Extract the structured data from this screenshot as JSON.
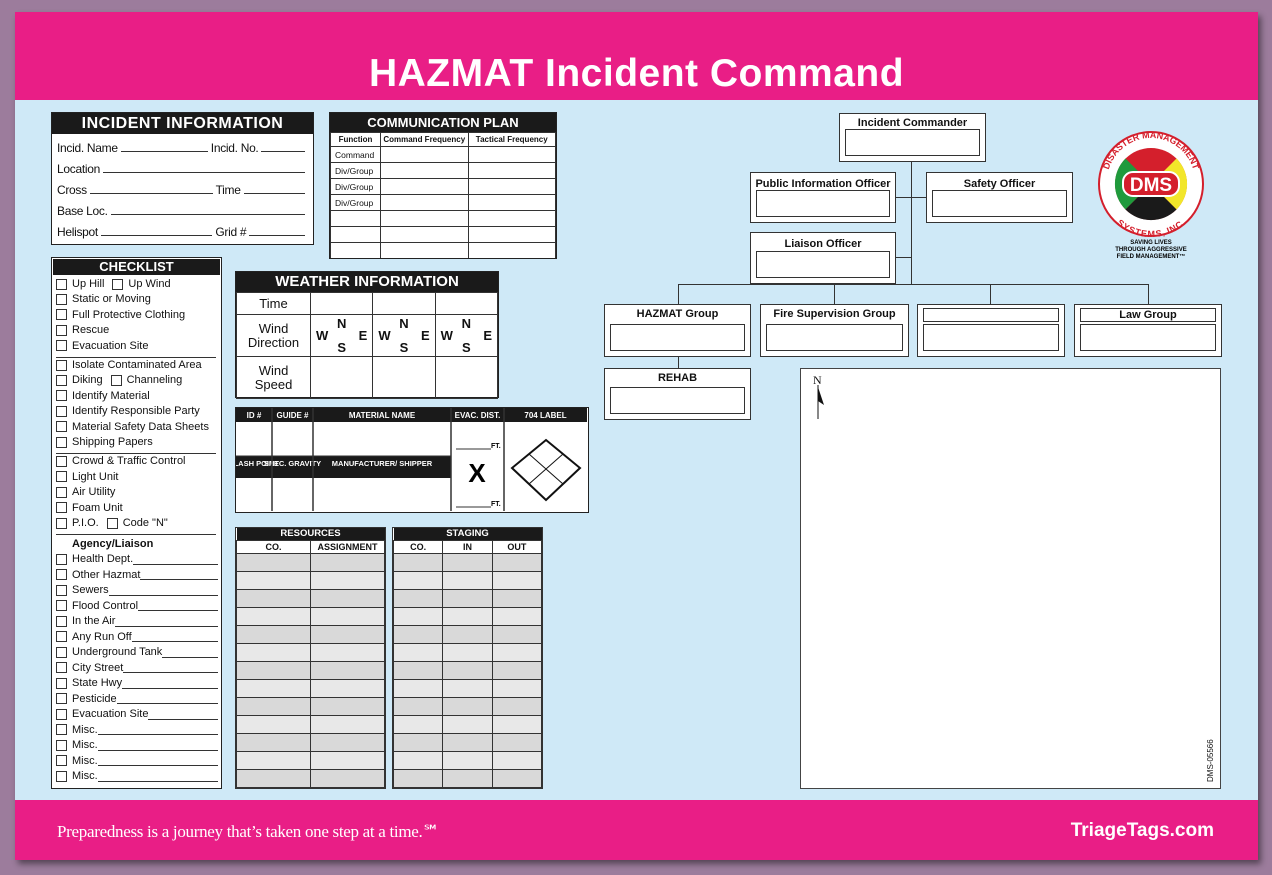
{
  "title": "HAZMAT Incident Command",
  "colors": {
    "brand_pink": "#e91e86",
    "board_blue": "#cfe9f7",
    "header_black": "#1a1a1a"
  },
  "incident_info": {
    "heading": "INCIDENT INFORMATION",
    "rows": [
      [
        "Incid. Name",
        "Incid. No."
      ],
      [
        "Location"
      ],
      [
        "Cross",
        "Time"
      ],
      [
        "Base Loc."
      ],
      [
        "Helispot",
        "Grid #"
      ]
    ]
  },
  "comm_plan": {
    "heading": "COMMUNICATION PLAN",
    "columns": [
      "Function",
      "Command Frequency",
      "Tactical Frequency"
    ],
    "rows": [
      "Command",
      "Div/Group",
      "Div/Group",
      "Div/Group",
      "",
      "",
      ""
    ]
  },
  "checklist": {
    "heading": "CHECKLIST",
    "groups": [
      [
        [
          "Up Hill",
          "Up Wind"
        ],
        [
          "Static or Moving"
        ],
        [
          "Full Protective Clothing"
        ],
        [
          "Rescue"
        ],
        [
          "Evacuation Site"
        ]
      ],
      [
        [
          "Isolate Contaminated Area"
        ],
        [
          "Diking",
          "Channeling"
        ],
        [
          "Identify Material"
        ],
        [
          "Identify Responsible Party"
        ],
        [
          "Material Safety Data Sheets"
        ],
        [
          "Shipping Papers"
        ]
      ],
      [
        [
          "Crowd & Traffic Control"
        ],
        [
          "Light Unit"
        ],
        [
          "Air Utility"
        ],
        [
          "Foam Unit"
        ],
        [
          "P.I.O.",
          "Code \"N\""
        ]
      ]
    ],
    "agency_heading": "Agency/Liaison",
    "agency_items": [
      "Health Dept.",
      "Other Hazmat",
      "Sewers",
      "Flood Control",
      "In the Air",
      "Any Run Off",
      "Underground Tank",
      "City Street",
      "State Hwy",
      "Pesticide",
      "Evacuation Site",
      "Misc.",
      "Misc.",
      "Misc.",
      "Misc."
    ]
  },
  "weather": {
    "heading": "WEATHER INFORMATION",
    "rows": [
      "Time",
      "Wind Direction",
      "Wind Speed"
    ],
    "compass": {
      "n": "N",
      "s": "S",
      "e": "E",
      "w": "W"
    }
  },
  "material": {
    "top_headers": [
      "ID #",
      "GUIDE #",
      "MATERIAL NAME",
      "EVAC. DIST.",
      "704 LABEL"
    ],
    "bottom_headers": [
      "FLASH POINT",
      "SPEC. GRAVITY",
      "MANUFACTURER/ SHIPPER"
    ],
    "ft": "FT.",
    "x_mark": "X"
  },
  "resources": {
    "heading": "RESOURCES",
    "columns": [
      "CO.",
      "ASSIGNMENT"
    ]
  },
  "staging": {
    "heading": "STAGING",
    "columns": [
      "CO.",
      "IN",
      "OUT"
    ]
  },
  "org_chart": {
    "incident_commander": "Incident Commander",
    "public_information_officer": "Public Information Officer",
    "safety_officer": "Safety Officer",
    "liaison_officer": "Liaison Officer",
    "groups": [
      "HAZMAT Group",
      "Fire Supervision Group",
      "",
      "Law Group"
    ],
    "rehab": "REHAB"
  },
  "map": {
    "north": "N"
  },
  "logo": {
    "ring_text_top": "DISASTER MANAGEMENT",
    "ring_text_bottom": "SYSTEMS, INC.",
    "center": "DMS",
    "tagline": [
      "SAVING LIVES",
      "THROUGH AGGRESSIVE",
      "FIELD MANAGEMENT™"
    ]
  },
  "form_code": "DMS-05566",
  "footer": {
    "slogan": "Preparedness is a journey that’s taken one step at a time.℠",
    "website": "TriageTags.com"
  }
}
